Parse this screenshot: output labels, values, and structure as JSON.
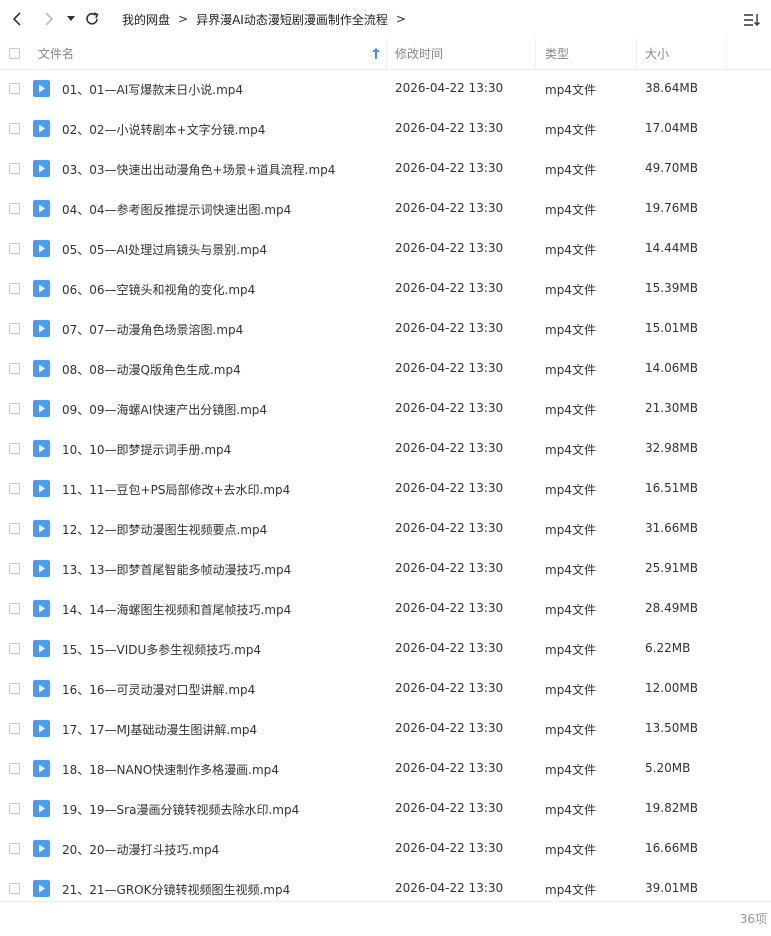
{
  "toolbar": {
    "breadcrumbs": [
      "我的网盘",
      "异界漫AI动态漫短剧漫画制作全流程"
    ],
    "back_icon": "back-arrow-icon",
    "forward_icon": "forward-arrow-icon",
    "history_icon": "caret-down-icon",
    "refresh_icon": "refresh-icon",
    "sort_icon": "sort-list-icon"
  },
  "columns": {
    "name": "文件名",
    "modified": "修改时间",
    "type": "类型",
    "size": "大小"
  },
  "files": [
    {
      "name": "01、01—AI写爆款末日小说.mp4",
      "modified": "2026-04-22 13:30",
      "type": "mp4文件",
      "size": "38.64MB"
    },
    {
      "name": "02、02—小说转剧本+文字分镜.mp4",
      "modified": "2026-04-22 13:30",
      "type": "mp4文件",
      "size": "17.04MB"
    },
    {
      "name": "03、03—快速出出动漫角色+场景+道具流程.mp4",
      "modified": "2026-04-22 13:30",
      "type": "mp4文件",
      "size": "49.70MB"
    },
    {
      "name": "04、04—参考图反推提示词快速出图.mp4",
      "modified": "2026-04-22 13:30",
      "type": "mp4文件",
      "size": "19.76MB"
    },
    {
      "name": "05、05—AI处理过肩镜头与景别.mp4",
      "modified": "2026-04-22 13:30",
      "type": "mp4文件",
      "size": "14.44MB"
    },
    {
      "name": "06、06—空镜头和视角的变化.mp4",
      "modified": "2026-04-22 13:30",
      "type": "mp4文件",
      "size": "15.39MB"
    },
    {
      "name": "07、07—动漫角色场景溶图.mp4",
      "modified": "2026-04-22 13:30",
      "type": "mp4文件",
      "size": "15.01MB"
    },
    {
      "name": "08、08—动漫Q版角色生成.mp4",
      "modified": "2026-04-22 13:30",
      "type": "mp4文件",
      "size": "14.06MB"
    },
    {
      "name": "09、09—海螺AI快速产出分镜图.mp4",
      "modified": "2026-04-22 13:30",
      "type": "mp4文件",
      "size": "21.30MB"
    },
    {
      "name": "10、10—即梦提示词手册.mp4",
      "modified": "2026-04-22 13:30",
      "type": "mp4文件",
      "size": "32.98MB"
    },
    {
      "name": "11、11—豆包+PS局部修改+去水印.mp4",
      "modified": "2026-04-22 13:30",
      "type": "mp4文件",
      "size": "16.51MB"
    },
    {
      "name": "12、12—即梦动漫图生视频要点.mp4",
      "modified": "2026-04-22 13:30",
      "type": "mp4文件",
      "size": "31.66MB"
    },
    {
      "name": "13、13—即梦首尾智能多帧动漫技巧.mp4",
      "modified": "2026-04-22 13:30",
      "type": "mp4文件",
      "size": "25.91MB"
    },
    {
      "name": "14、14—海螺图生视频和首尾帧技巧.mp4",
      "modified": "2026-04-22 13:30",
      "type": "mp4文件",
      "size": "28.49MB"
    },
    {
      "name": "15、15—VIDU多参生视频技巧.mp4",
      "modified": "2026-04-22 13:30",
      "type": "mp4文件",
      "size": "6.22MB"
    },
    {
      "name": "16、16—可灵动漫对口型讲解.mp4",
      "modified": "2026-04-22 13:30",
      "type": "mp4文件",
      "size": "12.00MB"
    },
    {
      "name": "17、17—MJ基础动漫生图讲解.mp4",
      "modified": "2026-04-22 13:30",
      "type": "mp4文件",
      "size": "13.50MB"
    },
    {
      "name": "18、18—NANO快速制作多格漫画.mp4",
      "modified": "2026-04-22 13:30",
      "type": "mp4文件",
      "size": "5.20MB"
    },
    {
      "name": "19、19—Sra漫画分镜转视频去除水印.mp4",
      "modified": "2026-04-22 13:30",
      "type": "mp4文件",
      "size": "19.82MB"
    },
    {
      "name": "20、20—动漫打斗技巧.mp4",
      "modified": "2026-04-22 13:30",
      "type": "mp4文件",
      "size": "16.66MB"
    },
    {
      "name": "21、21—GROK分镜转视频图生视频.mp4",
      "modified": "2026-04-22 13:30",
      "type": "mp4文件",
      "size": "39.01MB"
    }
  ],
  "footer": {
    "count": "36项"
  },
  "colors": {
    "accent": "#3b8ff0",
    "file_icon": "#4a9cf2"
  }
}
